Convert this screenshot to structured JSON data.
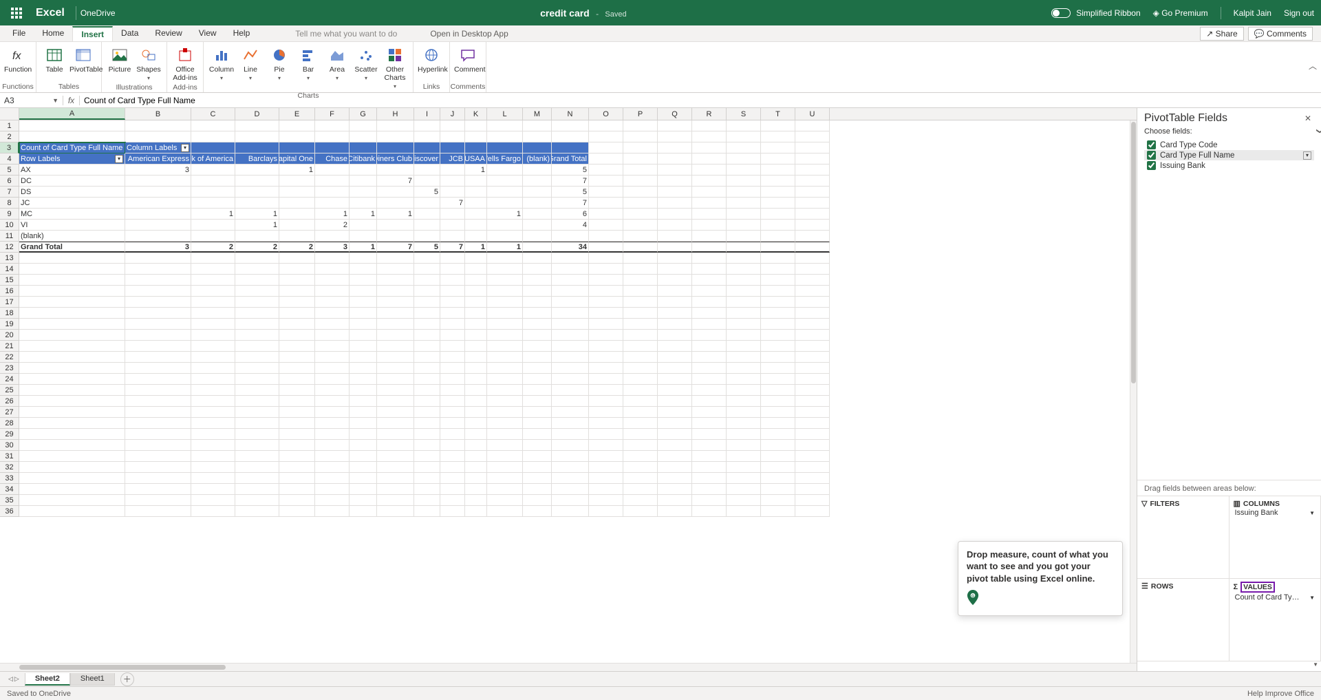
{
  "titleBar": {
    "appName": "Excel",
    "location": "OneDrive",
    "docName": "credit card",
    "savedLabel": "Saved",
    "simplified": "Simplified Ribbon",
    "premium": "Go Premium",
    "user": "Kalpit Jain",
    "signOut": "Sign out"
  },
  "menu": {
    "items": [
      "File",
      "Home",
      "Insert",
      "Data",
      "Review",
      "View",
      "Help"
    ],
    "active": "Insert",
    "tellMe": "Tell me what you want to do",
    "openDesktop": "Open in Desktop App",
    "share": "Share",
    "comments": "Comments"
  },
  "ribbon": {
    "groups": [
      {
        "label": "Functions",
        "buttons": [
          {
            "l": "Function",
            "a": false
          }
        ]
      },
      {
        "label": "Tables",
        "buttons": [
          {
            "l": "Table",
            "a": false
          },
          {
            "l": "PivotTable",
            "a": false
          }
        ]
      },
      {
        "label": "Illustrations",
        "buttons": [
          {
            "l": "Picture",
            "a": false
          },
          {
            "l": "Shapes",
            "a": true
          }
        ]
      },
      {
        "label": "Add-ins",
        "buttons": [
          {
            "l": "Office Add-ins",
            "a": false
          }
        ]
      },
      {
        "label": "Charts",
        "buttons": [
          {
            "l": "Column",
            "a": true
          },
          {
            "l": "Line",
            "a": true
          },
          {
            "l": "Pie",
            "a": true
          },
          {
            "l": "Bar",
            "a": true
          },
          {
            "l": "Area",
            "a": true
          },
          {
            "l": "Scatter",
            "a": true
          },
          {
            "l": "Other Charts",
            "a": true
          }
        ]
      },
      {
        "label": "Links",
        "buttons": [
          {
            "l": "Hyperlink",
            "a": false
          }
        ]
      },
      {
        "label": "Comments",
        "buttons": [
          {
            "l": "Comment",
            "a": false
          }
        ]
      }
    ]
  },
  "formula": {
    "nameBox": "A3",
    "value": "Count of Card Type Full Name"
  },
  "columns": {
    "A": 154,
    "B": 96,
    "C": 64,
    "D": 64,
    "E": 52,
    "F": 50,
    "G": 40,
    "H": 54,
    "I": 38,
    "J": 36,
    "K": 32,
    "L": 52,
    "M": 42,
    "N": 54,
    "O": 50,
    "P": 50,
    "Q": 50,
    "R": 50,
    "S": 50,
    "T": 50,
    "U": 50
  },
  "pivot": {
    "measureLabel": "Count of Card Type Full Name",
    "colLabel": "Column Labels",
    "rowLabel": "Row Labels",
    "columns": [
      "American Express",
      "Bank of America",
      "Barclays",
      "Capital One",
      "Chase",
      "Citibank",
      "Diners Club",
      "Discover",
      "JCB",
      "USAA",
      "Wells Fargo",
      "(blank)",
      "Grand Total"
    ],
    "rows": [
      {
        "k": "AX",
        "v": {
          "American Express": 3,
          "Capital One": 1,
          "USAA": 1,
          "Grand Total": 5
        }
      },
      {
        "k": "DC",
        "v": {
          "Diners Club": 7,
          "Grand Total": 7
        }
      },
      {
        "k": "DS",
        "v": {
          "Discover": 5,
          "Grand Total": 5
        }
      },
      {
        "k": "JC",
        "v": {
          "JCB": 7,
          "Grand Total": 7
        }
      },
      {
        "k": "MC",
        "v": {
          "Bank of America": 1,
          "Barclays": 1,
          "Chase": 1,
          "Citibank": 1,
          "Diners Club": 1,
          "Wells Fargo": 1,
          "Grand Total": 6
        }
      },
      {
        "k": "VI",
        "v": {
          "Barclays": 1,
          "Chase": 2,
          "Grand Total": 4
        }
      },
      {
        "k": "(blank)",
        "v": {}
      }
    ],
    "grandTotalLabel": "Grand Total",
    "grandTotal": {
      "American Express": 3,
      "Bank of America": 2,
      "Barclays": 2,
      "Capital One": 2,
      "Chase": 3,
      "Citibank": 1,
      "Diners Club": 7,
      "Discover": 5,
      "JCB": 7,
      "USAA": 1,
      "Wells Fargo": 1,
      "Grand Total": 34
    }
  },
  "pane": {
    "title": "PivotTable Fields",
    "choose": "Choose fields:",
    "fields": [
      {
        "name": "Card Type Code",
        "checked": true
      },
      {
        "name": "Card Type Full Name",
        "checked": true,
        "selected": true
      },
      {
        "name": "Issuing Bank",
        "checked": true
      }
    ],
    "dragHint": "Drag fields between areas below:",
    "areas": {
      "filters": {
        "label": "FILTERS",
        "items": []
      },
      "columns": {
        "label": "COLUMNS",
        "items": [
          "Issuing Bank"
        ]
      },
      "rows": {
        "label": "ROWS",
        "items": []
      },
      "values": {
        "label": "VALUES",
        "items": [
          "Count of Card Ty…"
        ]
      }
    }
  },
  "sheets": {
    "active": "Sheet2",
    "tabs": [
      "Sheet2",
      "Sheet1"
    ]
  },
  "status": {
    "left": "Saved to OneDrive",
    "right": "Help Improve Office"
  },
  "callout": "Drop measure, count of what you want to see and you got your pivot table using Excel online."
}
